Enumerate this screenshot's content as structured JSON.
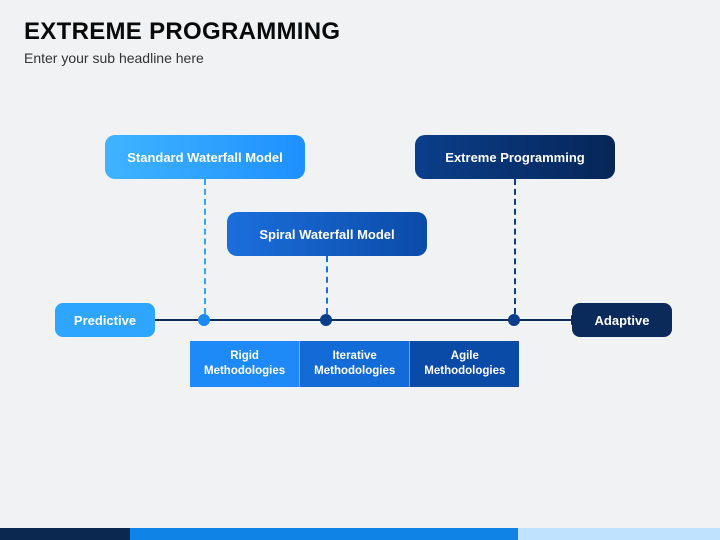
{
  "header": {
    "title": "EXTREME PROGRAMMING",
    "subtitle": "Enter your sub headline here"
  },
  "pills": {
    "waterfall": "Standard Waterfall Model",
    "spiral": "Spiral Waterfall Model",
    "xp": "Extreme Programming"
  },
  "axis": {
    "left": "Predictive",
    "right": "Adaptive"
  },
  "methods": {
    "a": "Rigid Methodologies",
    "b": "Iterative Methodologies",
    "c": "Agile Methodologies"
  }
}
